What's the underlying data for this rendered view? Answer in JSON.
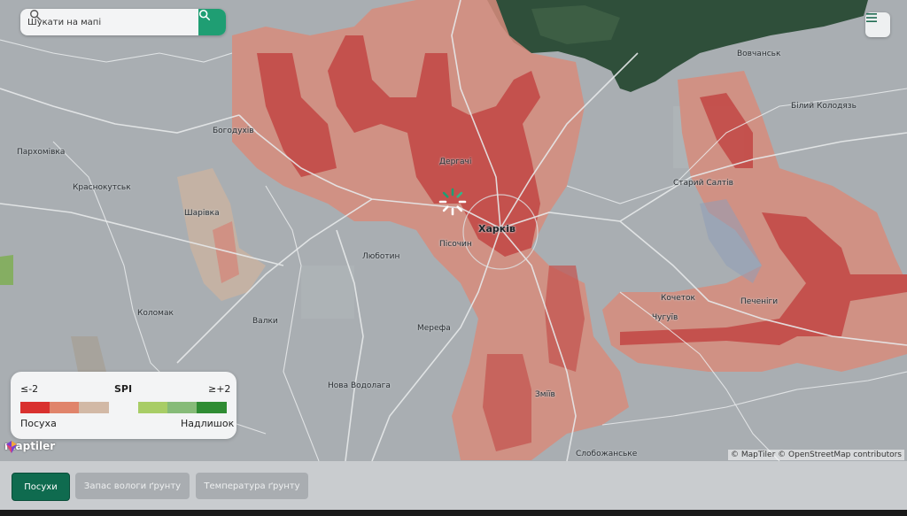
{
  "search": {
    "placeholder": "Шукати на мапі"
  },
  "legend": {
    "min_label": "≤-2",
    "title": "SPI",
    "max_label": "≥+2",
    "dry_label": "Посуха",
    "wet_label": "Надлишок",
    "colors": [
      "#d9312f",
      "#e0846b",
      "#d2b9a6",
      "#f3f4f5",
      "#a8cd66",
      "#86bb78",
      "#2f8c33"
    ]
  },
  "places": [
    {
      "name": "Харків",
      "major": true
    },
    {
      "name": "Дергачі"
    },
    {
      "name": "Пісочин"
    },
    {
      "name": "Люботин"
    },
    {
      "name": "Мерефа"
    },
    {
      "name": "Богодухів"
    },
    {
      "name": "Пархомівка"
    },
    {
      "name": "Краснокутськ"
    },
    {
      "name": "Шарівка"
    },
    {
      "name": "Коломак"
    },
    {
      "name": "Валки"
    },
    {
      "name": "Нова Водолага"
    },
    {
      "name": "Зміїв"
    },
    {
      "name": "Слобожанське"
    },
    {
      "name": "Чугуїв"
    },
    {
      "name": "Кочеток"
    },
    {
      "name": "Печеніги"
    },
    {
      "name": "Старий Салтів"
    },
    {
      "name": "Вовчанськ"
    },
    {
      "name": "Білий Колодязь"
    }
  ],
  "map_logo": "maptiler",
  "attribution": "© MapTiler © OpenStreetMap contributors",
  "tabs": [
    {
      "label": "Посухи",
      "active": true
    },
    {
      "label": "Запас вологи ґрунту",
      "active": false
    },
    {
      "label": "Температура ґрунту",
      "active": false
    }
  ],
  "icons": {
    "search": "search-icon",
    "menu": "hamburger-menu-icon",
    "loading": "loading-spinner-icon",
    "logo": "maptiler-logo-icon"
  }
}
